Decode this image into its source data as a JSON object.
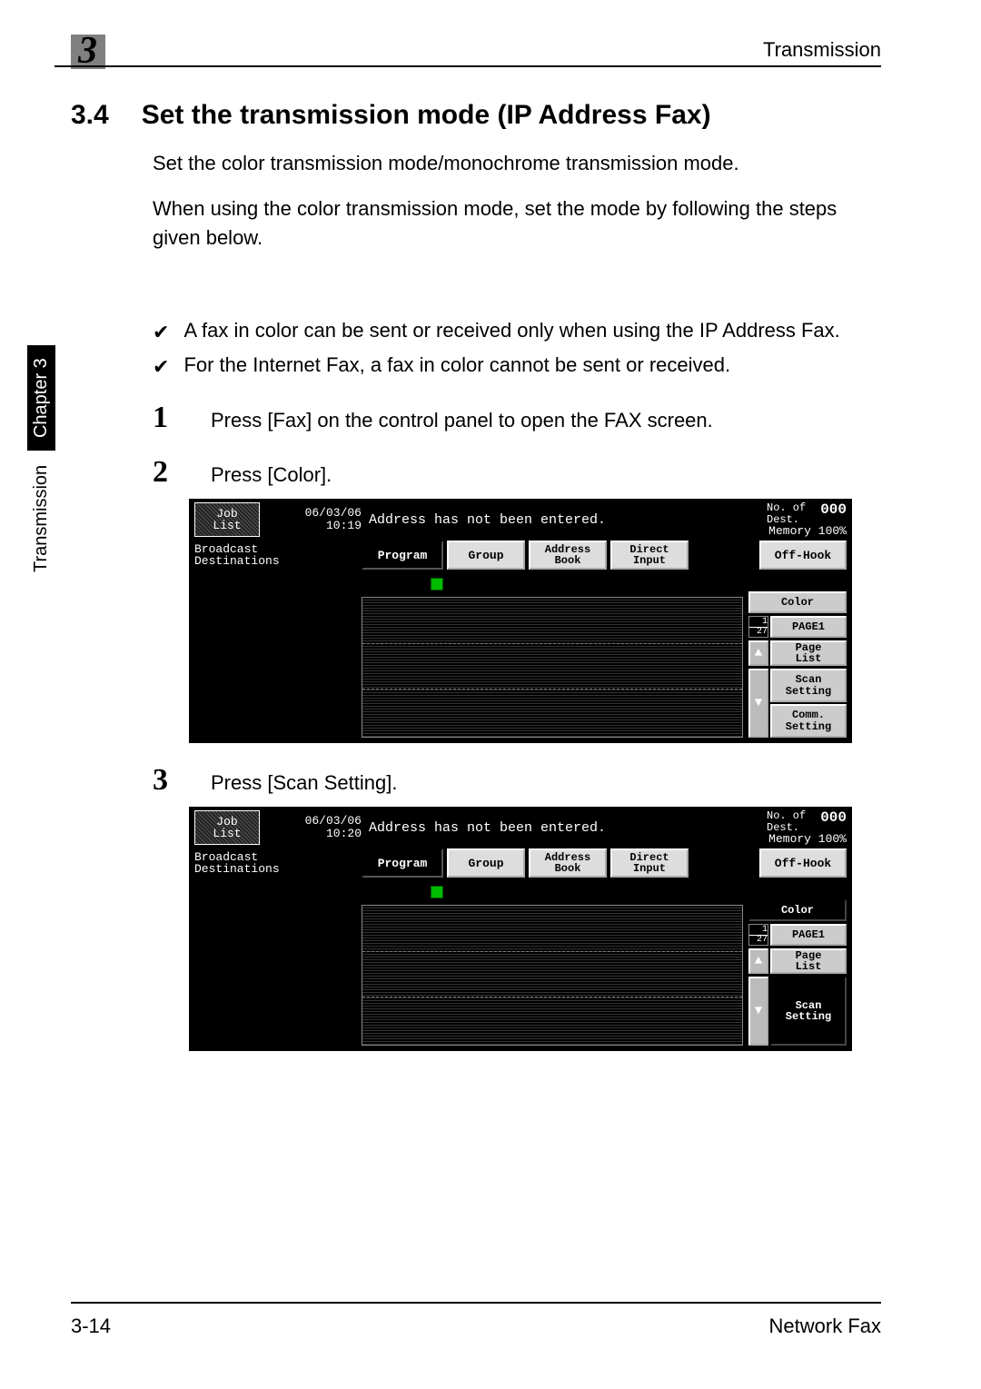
{
  "header": {
    "chapter_num": "3",
    "right_title": "Transmission"
  },
  "side": {
    "label": "Transmission",
    "chapter": "Chapter 3"
  },
  "section": {
    "number": "3.4",
    "title": "Set the transmission mode (IP Address Fax)"
  },
  "paragraphs": {
    "p1": "Set the color transmission mode/monochrome transmission mode.",
    "p2": "When using the color transmission mode, set the mode by following the steps given below."
  },
  "checks": {
    "c1": "A fax in color can be sent or received only when using the IP Address Fax.",
    "c2": "For the Internet Fax, a fax in color cannot be sent or received."
  },
  "steps": {
    "s1_num": "1",
    "s1_text": "Press [Fax] on the control panel to open the FAX screen.",
    "s2_num": "2",
    "s2_text": "Press [Color].",
    "s3_num": "3",
    "s3_text": "Press [Scan Setting]."
  },
  "lcd_common": {
    "job_list_l1": "Job",
    "job_list_l2": "List",
    "status_msg": "Address has not been entered.",
    "noof_l1": "No. of",
    "noof_l2": "Dest.",
    "noof_count": "000",
    "memory": "Memory 100%",
    "broadcast_l1": "Broadcast",
    "broadcast_l2": "Destinations",
    "tab_program": "Program",
    "tab_group": "Group",
    "tab_addr_l1": "Address",
    "tab_addr_l2": "Book",
    "tab_direct_l1": "Direct",
    "tab_direct_l2": "Input",
    "offhook": "Off-Hook",
    "btn_color": "Color",
    "page_frac_top": "1",
    "page_frac_bot": "27",
    "btn_page": "PAGE1",
    "btn_pagelist_l1": "Page",
    "btn_pagelist_l2": "List",
    "btn_scan_l1": "Scan",
    "btn_scan_l2": "Setting",
    "btn_comm_l1": "Comm.",
    "btn_comm_l2": "Setting"
  },
  "lcd1": {
    "date": "06/03/06",
    "time": "10:19"
  },
  "lcd2": {
    "date": "06/03/06",
    "time": "10:20"
  },
  "footer": {
    "left": "3-14",
    "right": "Network Fax"
  }
}
